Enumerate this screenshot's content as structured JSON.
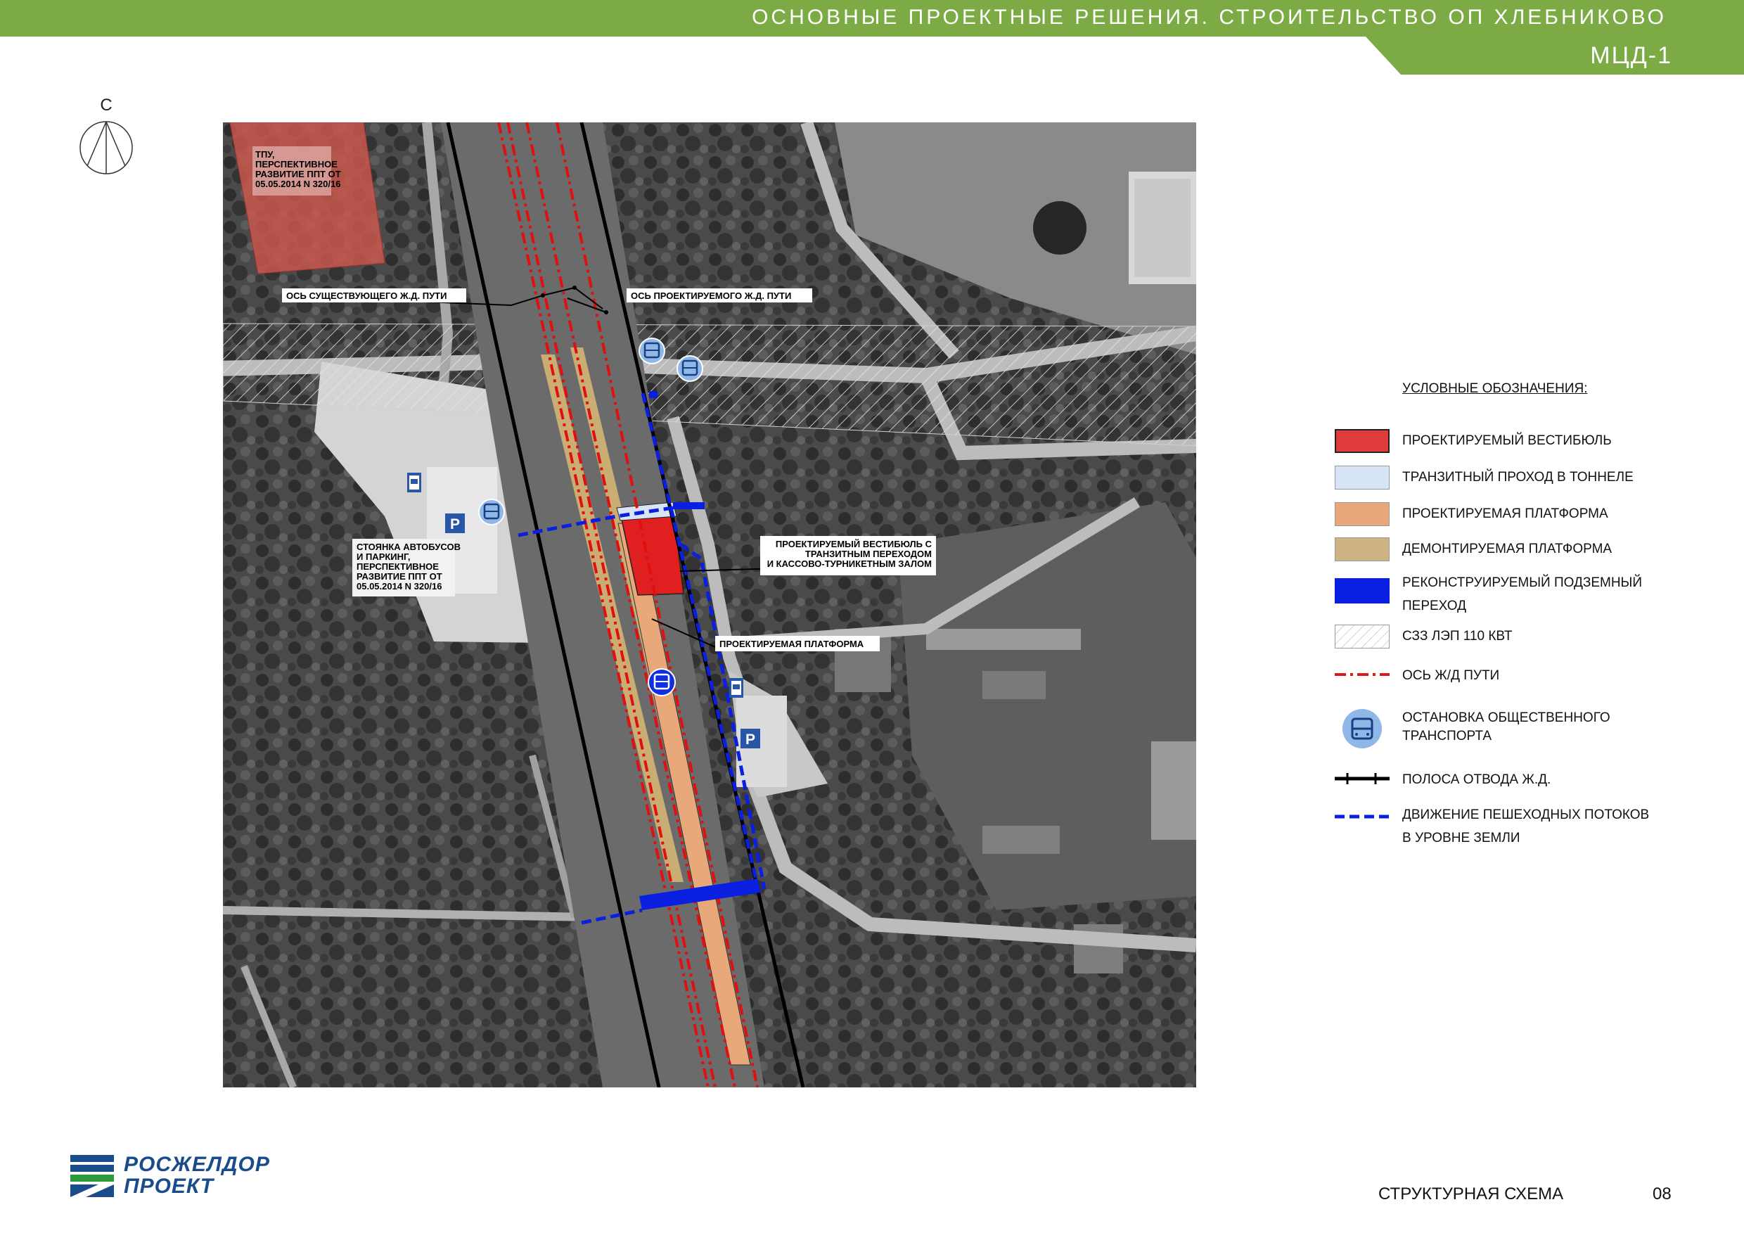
{
  "header": {
    "title": "ОСНОВНЫЕ ПРОЕКТНЫЕ РЕШЕНИЯ. СТРОИТЕЛЬСТВО  ОП  ХЛЕБНИКОВО",
    "subtitle": "МЦД-1",
    "band_color": "#7cab46"
  },
  "compass": {
    "label": "С"
  },
  "map": {
    "labels": {
      "tpu": [
        "ТПУ,",
        "ПЕРСПЕКТИВНОЕ",
        "РАЗВИТИЕ ППТ ОТ",
        "05.05.2014 N 320/16"
      ],
      "existing_axis": "ОСЬ СУЩЕСТВУЮЩЕГО Ж.Д. ПУТИ",
      "projected_axis": "ОСЬ ПРОЕКТИРУЕМОГО Ж.Д. ПУТИ",
      "bus_parking": [
        "СТОЯНКА АВТОБУСОВ",
        "И ПАРКИНГ,",
        "ПЕРСПЕКТИВНОЕ",
        "РАЗВИТИЕ ППТ ОТ",
        "05.05.2014 N 320/16"
      ],
      "vestibule": [
        "ПРОЕКТИРУЕМЫЙ ВЕСТИБЮЛЬ С",
        "ТРАНЗИТНЫМ ПЕРЕХОДОМ",
        "И КАССОВО-ТУРНИКЕТНЫМ ЗАЛОМ"
      ],
      "platform": "ПРОЕКТИРУЕМАЯ ПЛАТФОРМА",
      "parking_sign": "P"
    }
  },
  "legend": {
    "title": "УСЛОВНЫЕ ОБОЗНАЧЕНИЯ:",
    "items": [
      {
        "label": "ПРОЕКТИРУЕМЫЙ ВЕСТИБЮЛЬ",
        "color": "#e03c3c"
      },
      {
        "label": "ТРАНЗИТНЫЙ ПРОХОД В ТОННЕЛЕ",
        "color": "#d6e4f6"
      },
      {
        "label": "ПРОЕКТИРУЕМАЯ ПЛАТФОРМА",
        "color": "#e8a87a"
      },
      {
        "label": "ДЕМОНТИРУЕМАЯ ПЛАТФОРМА",
        "color": "#cdb482"
      },
      {
        "label": [
          "РЕКОНСТРУИРУЕМЫЙ ПОДЗЕМНЫЙ",
          "ПЕРЕХОД"
        ],
        "color": "#0a1fe0"
      },
      {
        "label": "СЗЗ ЛЭП 110 КВТ",
        "color": "#ffffff"
      },
      {
        "label": "ОСЬ Ж/Д ПУТИ",
        "color": "#d71920"
      },
      {
        "label": [
          "ОСТАНОВКА ОБЩЕСТВЕННОГО",
          "ТРАНСПОРТА"
        ],
        "color": "#8fb7e8",
        "icon": "bus-stop-icon"
      },
      {
        "label": "ПОЛОСА ОТВОДА Ж.Д.",
        "color": "#000000"
      },
      {
        "label": [
          "ДВИЖЕНИЕ ПЕШЕХОДНЫХ ПОТОКОВ",
          "В УРОВНЕ ЗЕМЛИ"
        ],
        "color": "#0a1fe0"
      }
    ]
  },
  "logo": {
    "line1": "РОСЖЕЛДОР",
    "line2": "ПРОЕКТ",
    "color": "#1a4c8c",
    "accent": "#2a9a3a"
  },
  "footer": {
    "label": "СТРУКТУРНАЯ СХЕМА",
    "page": "08"
  }
}
